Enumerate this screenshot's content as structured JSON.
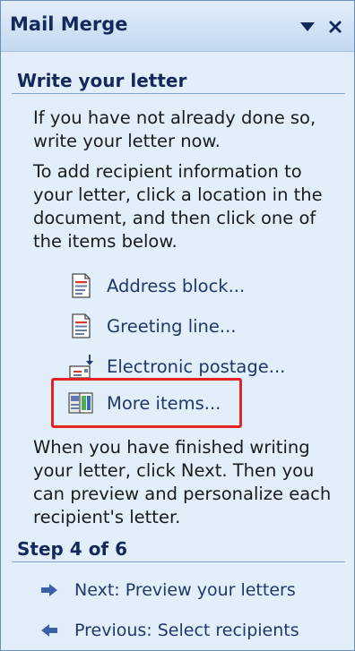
{
  "pane": {
    "title": "Mail Merge",
    "dropdown_icon": "chevron-down-icon",
    "close_icon": "close-icon"
  },
  "write_section": {
    "header": "Write your letter",
    "paragraph1": [
      "If you have not already done so,",
      "write your letter now."
    ],
    "paragraph2": [
      "To add recipient information to",
      "your letter, click a location in the",
      "document, and then click one of",
      "the items below."
    ],
    "items": [
      {
        "label": "Address block...",
        "icon": "address-block-icon"
      },
      {
        "label": "Greeting line...",
        "icon": "greeting-line-icon"
      },
      {
        "label": "Electronic postage...",
        "icon": "electronic-postage-icon"
      },
      {
        "label": "More items...",
        "icon": "more-items-icon",
        "highlighted": true
      }
    ],
    "paragraph3": [
      "When you have finished writing",
      "your letter, click Next. Then you",
      "can preview and personalize each",
      "recipient's letter."
    ]
  },
  "step_section": {
    "header": "Step 4 of 6",
    "next": {
      "label": "Next: Preview your letters",
      "icon": "arrow-right-icon"
    },
    "previous": {
      "label": "Previous: Select recipients",
      "icon": "arrow-left-icon"
    }
  },
  "colors": {
    "pane_background": "#e2effb",
    "header_text": "#13295c",
    "highlight_border": "#e42323",
    "rule": "#7fa2cf"
  }
}
